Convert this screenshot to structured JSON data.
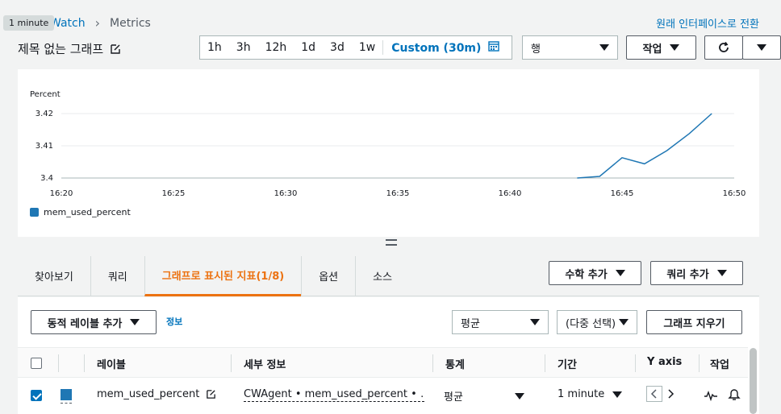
{
  "tooltip": "1 minute",
  "breadcrumb": {
    "parent": "Watch",
    "current": "Metrics"
  },
  "old_ui_link": "원래 인터페이스로 전환",
  "graph_title": "제목 없는 그래프",
  "time_range": {
    "options": [
      "1h",
      "3h",
      "12h",
      "1d",
      "3d",
      "1w"
    ],
    "custom": "Custom (30m)"
  },
  "view_select": "행",
  "actions_button": "작업",
  "chart_data": {
    "type": "line",
    "ylabel": "Percent",
    "x_ticks": [
      "16:20",
      "16:25",
      "16:30",
      "16:35",
      "16:40",
      "16:45",
      "16:50"
    ],
    "ylim": [
      3.4,
      3.42
    ],
    "y_ticks": [
      "3.4",
      "3.41",
      "3.42"
    ],
    "grid": true,
    "legend_position": "bottom-left",
    "series": [
      {
        "name": "mem_used_percent",
        "color": "#1f77b4",
        "x": [
          "16:43",
          "16:44",
          "16:45",
          "16:46",
          "16:47",
          "16:48",
          "16:49"
        ],
        "values": [
          3.4,
          3.4005,
          3.4063,
          3.4044,
          3.4085,
          3.4138,
          3.42
        ]
      }
    ]
  },
  "tabs": [
    "찾아보기",
    "쿼리",
    "그래프로 표시된 지표(1/8)",
    "옵션",
    "소스"
  ],
  "add_math_button": "수학 추가",
  "add_query_button": "쿼리 추가",
  "dynamic_label_button": "동적 레이블 추가",
  "info_link": "정보",
  "stat_select": "평균",
  "multi_select": "(다중 선택)",
  "clear_graph_button": "그래프 지우기",
  "table": {
    "headers": [
      "레이블",
      "세부 정보",
      "통계",
      "기간",
      "Y axis",
      "작업"
    ],
    "rows": [
      {
        "label": "mem_used_percent",
        "details": "CWAgent • mem_used_percent • …",
        "stat": "평균",
        "period": "1 minute"
      }
    ]
  }
}
